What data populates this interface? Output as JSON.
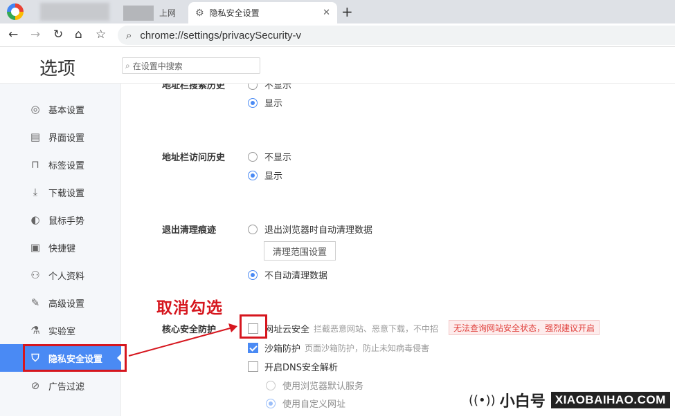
{
  "browser": {
    "tabs": [
      {
        "label": "上网",
        "active": false
      },
      {
        "label": "隐私安全设置",
        "active": true
      }
    ],
    "tab_close": "✕",
    "new_tab": "+",
    "url": "chrome://settings/privacySecurity-v"
  },
  "settings": {
    "title": "选项",
    "search_placeholder": "在设置中搜索"
  },
  "sidebar": {
    "items": [
      {
        "label": "基本设置",
        "icon": "target-icon",
        "glyph": "◎"
      },
      {
        "label": "界面设置",
        "icon": "window-icon",
        "glyph": "▤"
      },
      {
        "label": "标签设置",
        "icon": "tab-icon",
        "glyph": "⊓"
      },
      {
        "label": "下载设置",
        "icon": "download-icon",
        "glyph": "⤓"
      },
      {
        "label": "鼠标手势",
        "icon": "mouse-icon",
        "glyph": "◐"
      },
      {
        "label": "快捷键",
        "icon": "keyboard-icon",
        "glyph": "▣"
      },
      {
        "label": "个人资料",
        "icon": "user-icon",
        "glyph": "⚇"
      },
      {
        "label": "高级设置",
        "icon": "wrench-icon",
        "glyph": "✎"
      },
      {
        "label": "实验室",
        "icon": "flask-icon",
        "glyph": "⚗"
      },
      {
        "label": "隐私安全设置",
        "icon": "shield-icon",
        "glyph": "⛉"
      },
      {
        "label": "广告过滤",
        "icon": "block-icon",
        "glyph": "⊘"
      }
    ],
    "active_index": 9
  },
  "content": {
    "addr_search_history": {
      "label": "地址栏搜索历史",
      "options": [
        "不显示",
        "显示"
      ],
      "selected": "显示"
    },
    "addr_visit_history": {
      "label": "地址栏访问历史",
      "options": [
        "不显示",
        "显示"
      ],
      "selected": "显示"
    },
    "exit_cleanup": {
      "label": "退出清理痕迹",
      "option_auto": "退出浏览器时自动清理数据",
      "scope_button": "清理范围设置",
      "option_none": "不自动清理数据",
      "selected": "不自动清理数据"
    },
    "core_security": {
      "label": "核心安全防护",
      "url_cloud": {
        "label": "网址云安全",
        "desc": "拦截恶意网站、恶意下载，不中招",
        "checked": false
      },
      "warning": "无法查询网站安全状态，强烈建议开启",
      "sandbox": {
        "label": "沙箱防护",
        "desc": "页面沙箱防护，防止未知病毒侵害",
        "checked": true
      },
      "dns": {
        "label": "开启DNS安全解析",
        "checked": false
      },
      "dns_default": "使用浏览器默认服务",
      "dns_custom": "使用自定义网址"
    }
  },
  "annotation": {
    "text": "取消勾选",
    "color": "#d6161e"
  },
  "watermark": {
    "cn": "小白号",
    "en": "XIAOBAIHAO.COM"
  },
  "colors": {
    "accent": "#4a8af4",
    "annotation": "#d6161e",
    "warning": "#e0403c"
  }
}
